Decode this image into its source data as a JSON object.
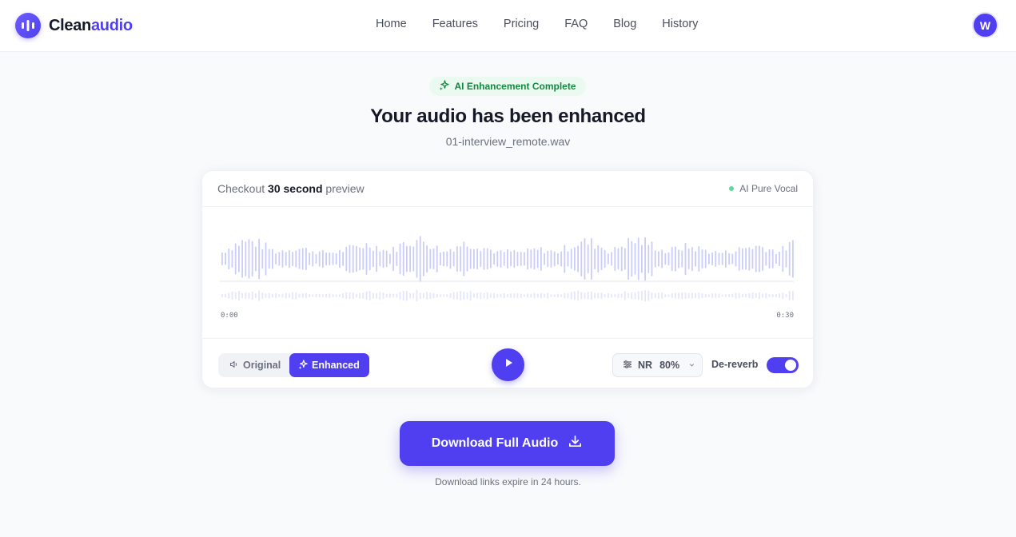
{
  "brand": {
    "name_part1": "Clean",
    "name_part2": "audio",
    "accent": "#4f3ff0"
  },
  "nav": {
    "items": [
      {
        "label": "Home"
      },
      {
        "label": "Features"
      },
      {
        "label": "Pricing"
      },
      {
        "label": "FAQ"
      },
      {
        "label": "Blog"
      },
      {
        "label": "History"
      }
    ]
  },
  "user": {
    "initial": "W"
  },
  "hero": {
    "badge": "AI Enhancement Complete",
    "badge_icon": "sparkles-icon",
    "title": "Your audio has been enhanced",
    "filename": "01-interview_remote.wav"
  },
  "preview": {
    "prefix": "Checkout",
    "duration": "30 second",
    "suffix": "preview",
    "mode_label": "AI Pure Vocal",
    "mode_color": "#5fd99a",
    "time_start": "0:00",
    "time_end": "0:30"
  },
  "controls": {
    "original_label": "Original",
    "enhanced_label": "Enhanced",
    "selected": "Enhanced",
    "nr_label": "NR",
    "nr_value": "80%",
    "dereverb_label": "De-reverb",
    "dereverb_on": true
  },
  "download": {
    "button_label": "Download Full Audio",
    "note": "Download links expire in 24 hours."
  }
}
